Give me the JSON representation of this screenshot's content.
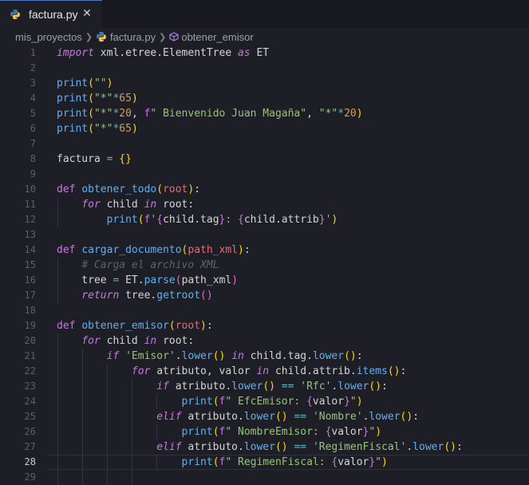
{
  "tab": {
    "filename": "factura.py",
    "close_glyph": "✕"
  },
  "breadcrumb": {
    "folder": "mis_proyectos",
    "file": "factura.py",
    "symbol": "obtener_emisor"
  },
  "colors": {
    "accent": "#4d78cc",
    "background": "#1e1f26"
  },
  "editor": {
    "active_line": 28,
    "lines": [
      {
        "n": "1",
        "tokens": [
          [
            "kw",
            "import"
          ],
          [
            "t",
            " xml.etree.ElementTree "
          ],
          [
            "kw",
            "as"
          ],
          [
            "t",
            " ET"
          ]
        ]
      },
      {
        "n": "2",
        "tokens": []
      },
      {
        "n": "3",
        "tokens": [
          [
            "fn",
            "print"
          ],
          [
            "par",
            "("
          ],
          [
            "str2",
            "\"\""
          ],
          [
            "par",
            ")"
          ]
        ]
      },
      {
        "n": "4",
        "tokens": [
          [
            "fn",
            "print"
          ],
          [
            "par",
            "("
          ],
          [
            "str2",
            "\"*\""
          ],
          [
            "op",
            "*"
          ],
          [
            "num",
            "65"
          ],
          [
            "par",
            ")"
          ]
        ]
      },
      {
        "n": "5",
        "tokens": [
          [
            "fn",
            "print"
          ],
          [
            "par",
            "("
          ],
          [
            "str2",
            "\"*\""
          ],
          [
            "op",
            "*"
          ],
          [
            "num",
            "20"
          ],
          [
            "t",
            ", "
          ],
          [
            "kw2",
            "f"
          ],
          [
            "str2",
            "\" Bienvenido Juan Magaña\""
          ],
          [
            "t",
            ", "
          ],
          [
            "str2",
            "\"*\""
          ],
          [
            "op",
            "*"
          ],
          [
            "num",
            "20"
          ],
          [
            "par",
            ")"
          ]
        ]
      },
      {
        "n": "6",
        "tokens": [
          [
            "fn",
            "print"
          ],
          [
            "par",
            "("
          ],
          [
            "str2",
            "\"*\""
          ],
          [
            "op",
            "*"
          ],
          [
            "num",
            "65"
          ],
          [
            "par",
            ")"
          ]
        ]
      },
      {
        "n": "7",
        "tokens": []
      },
      {
        "n": "8",
        "tokens": [
          [
            "t",
            "factura "
          ],
          [
            "op",
            "="
          ],
          [
            "t",
            " "
          ],
          [
            "par",
            "{}"
          ]
        ]
      },
      {
        "n": "9",
        "tokens": []
      },
      {
        "n": "10",
        "tokens": [
          [
            "kw2",
            "def"
          ],
          [
            "t",
            " "
          ],
          [
            "fn",
            "obtener_todo"
          ],
          [
            "par",
            "("
          ],
          [
            "cls",
            "root"
          ],
          [
            "par",
            ")"
          ],
          [
            "t",
            ":"
          ]
        ]
      },
      {
        "n": "11",
        "tokens": [
          [
            "t",
            "    "
          ],
          [
            "kw",
            "for"
          ],
          [
            "t",
            " child "
          ],
          [
            "kw",
            "in"
          ],
          [
            "t",
            " root:"
          ]
        ]
      },
      {
        "n": "12",
        "tokens": [
          [
            "t",
            "        "
          ],
          [
            "fn",
            "print"
          ],
          [
            "par",
            "("
          ],
          [
            "kw2",
            "f"
          ],
          [
            "str2",
            "'"
          ],
          [
            "interp",
            "{"
          ],
          [
            "t",
            "child.tag"
          ],
          [
            "interp",
            "}"
          ],
          [
            "str2",
            ": "
          ],
          [
            "interp",
            "{"
          ],
          [
            "t",
            "child.attrib"
          ],
          [
            "interp",
            "}"
          ],
          [
            "str2",
            "'"
          ],
          [
            "par",
            ")"
          ]
        ]
      },
      {
        "n": "13",
        "tokens": []
      },
      {
        "n": "14",
        "tokens": [
          [
            "kw2",
            "def"
          ],
          [
            "t",
            " "
          ],
          [
            "fn",
            "cargar_documento"
          ],
          [
            "par",
            "("
          ],
          [
            "cls",
            "path_xml"
          ],
          [
            "par",
            ")"
          ],
          [
            "t",
            ":"
          ]
        ]
      },
      {
        "n": "15",
        "tokens": [
          [
            "t",
            "    "
          ],
          [
            "cmt",
            "# Carga el archivo XML"
          ]
        ]
      },
      {
        "n": "16",
        "tokens": [
          [
            "t",
            "    tree "
          ],
          [
            "op",
            "="
          ],
          [
            "t",
            " ET."
          ],
          [
            "fn",
            "parse"
          ],
          [
            "par2",
            "("
          ],
          [
            "t",
            "path_xml"
          ],
          [
            "par2",
            ")"
          ]
        ]
      },
      {
        "n": "17",
        "tokens": [
          [
            "t",
            "    "
          ],
          [
            "kw",
            "return"
          ],
          [
            "t",
            " tree."
          ],
          [
            "fn",
            "getroot"
          ],
          [
            "par2",
            "()"
          ]
        ]
      },
      {
        "n": "18",
        "tokens": []
      },
      {
        "n": "19",
        "tokens": [
          [
            "kw2",
            "def"
          ],
          [
            "t",
            " "
          ],
          [
            "fn",
            "obtener_emisor"
          ],
          [
            "par",
            "("
          ],
          [
            "cls",
            "root"
          ],
          [
            "par",
            ")"
          ],
          [
            "t",
            ":"
          ]
        ]
      },
      {
        "n": "20",
        "tokens": [
          [
            "t",
            "    "
          ],
          [
            "kw",
            "for"
          ],
          [
            "t",
            " child "
          ],
          [
            "kw",
            "in"
          ],
          [
            "t",
            " root:"
          ]
        ]
      },
      {
        "n": "21",
        "tokens": [
          [
            "t",
            "        "
          ],
          [
            "kw",
            "if"
          ],
          [
            "t",
            " "
          ],
          [
            "str2",
            "'Emisor'"
          ],
          [
            "t",
            "."
          ],
          [
            "fn",
            "lower"
          ],
          [
            "par",
            "()"
          ],
          [
            "t",
            " "
          ],
          [
            "kw",
            "in"
          ],
          [
            "t",
            " child.tag."
          ],
          [
            "fn",
            "lower"
          ],
          [
            "par",
            "()"
          ],
          [
            "t",
            ":"
          ]
        ]
      },
      {
        "n": "22",
        "tokens": [
          [
            "t",
            "            "
          ],
          [
            "kw",
            "for"
          ],
          [
            "t",
            " atributo, valor "
          ],
          [
            "kw",
            "in"
          ],
          [
            "t",
            " child.attrib."
          ],
          [
            "fn",
            "items"
          ],
          [
            "par",
            "()"
          ],
          [
            "t",
            ":"
          ]
        ]
      },
      {
        "n": "23",
        "tokens": [
          [
            "t",
            "                "
          ],
          [
            "kw",
            "if"
          ],
          [
            "t",
            " atributo."
          ],
          [
            "fn",
            "lower"
          ],
          [
            "par",
            "()"
          ],
          [
            "t",
            " "
          ],
          [
            "op",
            "=="
          ],
          [
            "t",
            " "
          ],
          [
            "str2",
            "'Rfc'"
          ],
          [
            "t",
            "."
          ],
          [
            "fn",
            "lower"
          ],
          [
            "par",
            "()"
          ],
          [
            "t",
            ":"
          ]
        ]
      },
      {
        "n": "24",
        "tokens": [
          [
            "t",
            "                    "
          ],
          [
            "fn",
            "print"
          ],
          [
            "par",
            "("
          ],
          [
            "kw2",
            "f"
          ],
          [
            "str2",
            "\" EfcEmisor: "
          ],
          [
            "interp",
            "{"
          ],
          [
            "t",
            "valor"
          ],
          [
            "interp",
            "}"
          ],
          [
            "str2",
            "\""
          ],
          [
            "par",
            ")"
          ]
        ]
      },
      {
        "n": "25",
        "tokens": [
          [
            "t",
            "                "
          ],
          [
            "kw",
            "elif"
          ],
          [
            "t",
            " atributo."
          ],
          [
            "fn",
            "lower"
          ],
          [
            "par",
            "()"
          ],
          [
            "t",
            " "
          ],
          [
            "op",
            "=="
          ],
          [
            "t",
            " "
          ],
          [
            "str2",
            "'Nombre'"
          ],
          [
            "t",
            "."
          ],
          [
            "fn",
            "lower"
          ],
          [
            "par",
            "()"
          ],
          [
            "t",
            ":"
          ]
        ]
      },
      {
        "n": "26",
        "tokens": [
          [
            "t",
            "                    "
          ],
          [
            "fn",
            "print"
          ],
          [
            "par",
            "("
          ],
          [
            "kw2",
            "f"
          ],
          [
            "str2",
            "\" NombreEmisor: "
          ],
          [
            "interp",
            "{"
          ],
          [
            "t",
            "valor"
          ],
          [
            "interp",
            "}"
          ],
          [
            "str2",
            "\""
          ],
          [
            "par",
            ")"
          ]
        ]
      },
      {
        "n": "27",
        "tokens": [
          [
            "t",
            "                "
          ],
          [
            "kw",
            "elif"
          ],
          [
            "t",
            " atributo."
          ],
          [
            "fn",
            "lower"
          ],
          [
            "par",
            "()"
          ],
          [
            "t",
            " "
          ],
          [
            "op",
            "=="
          ],
          [
            "t",
            " "
          ],
          [
            "str2",
            "'RegimenFiscal'"
          ],
          [
            "t",
            "."
          ],
          [
            "fn",
            "lower"
          ],
          [
            "par",
            "()"
          ],
          [
            "t",
            ":"
          ]
        ]
      },
      {
        "n": "28",
        "tokens": [
          [
            "t",
            "                    "
          ],
          [
            "fn",
            "print"
          ],
          [
            "par",
            "("
          ],
          [
            "kw2",
            "f"
          ],
          [
            "str2",
            "\" RegimenFiscal: "
          ],
          [
            "interp",
            "{"
          ],
          [
            "t",
            "valor"
          ],
          [
            "interp",
            "}"
          ],
          [
            "str2",
            "\""
          ],
          [
            "par",
            ")"
          ]
        ]
      },
      {
        "n": "29",
        "tokens": []
      }
    ]
  }
}
